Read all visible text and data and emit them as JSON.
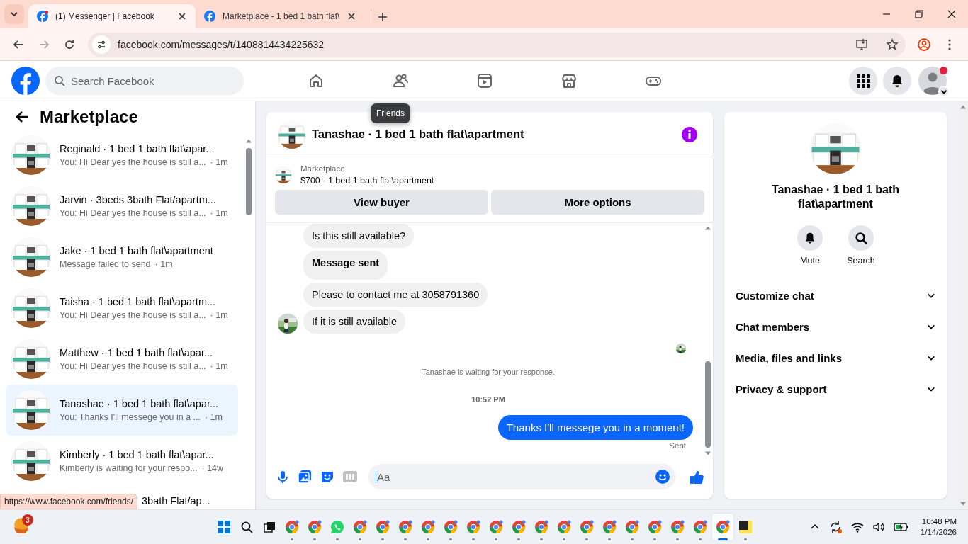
{
  "browser": {
    "tabs": [
      {
        "title": "(1) Messenger | Facebook",
        "selected": true,
        "unread": true
      },
      {
        "title": "Marketplace - 1 bed 1 bath flat\\",
        "selected": false,
        "unread": false
      }
    ],
    "url": "facebook.com/messages/t/1408814434225632"
  },
  "topnav": {
    "search_placeholder": "Search Facebook",
    "profile_alert": true,
    "tooltip": "Friends"
  },
  "sidebar": {
    "title": "Marketplace",
    "conversations": [
      {
        "kind": "full",
        "name": "Reginald · 1 bed 1 bath flat\\apar...",
        "preview": "You: Hi Dear yes the house is still a...",
        "time": "· 1m",
        "selected": false
      },
      {
        "kind": "full",
        "name": "Jarvin · 3beds 3bath Flat/apartm...",
        "preview": "You: Hi Dear yes the house is still a...",
        "time": "· 1m",
        "selected": false
      },
      {
        "kind": "full",
        "name": "Jake · 1 bed 1 bath flat\\apartment",
        "preview": "Message failed to send",
        "time": "· 1m",
        "selected": false
      },
      {
        "kind": "full",
        "name": "Taisha · 1 bed 1 bath flat\\apartm...",
        "preview": "You: Hi Dear yes the house is still a...",
        "time": "· 1m",
        "selected": false
      },
      {
        "kind": "full",
        "name": "Matthew · 1 bed 1 bath flat\\apar...",
        "preview": "You: Hi Dear yes the house is still a...",
        "time": "· 1m",
        "selected": false
      },
      {
        "kind": "full",
        "name": "Tanashae · 1 bed 1 bath flat\\apar...",
        "preview": "You: Thanks I'll messege you in a ...",
        "time": "· 1m",
        "selected": true
      },
      {
        "kind": "full",
        "name": "Kimberly · 1 bed 1 bath flat\\apar...",
        "preview": "Kimberly is waiting for your respo...",
        "time": "· 14w",
        "selected": false
      },
      {
        "kind": "partial",
        "name": "3bath Flat/ap...",
        "selected": false
      }
    ],
    "link_preview": "https://www.facebook.com/friends/"
  },
  "chat": {
    "title": "Tanashae · 1 bed 1 bath flat\\apartment",
    "listing": {
      "label": "Marketplace",
      "title": "$700 - 1 bed 1 bath flat\\apartment"
    },
    "buttons": [
      "View buyer",
      "More options"
    ],
    "messages": [
      {
        "kind": "incoming",
        "text": "Is this still available?"
      },
      {
        "kind": "incoming_bold",
        "text": "Message sent"
      },
      {
        "kind": "incoming",
        "text": "Please to contact me at 3058791360"
      },
      {
        "kind": "incoming_avatar",
        "text": "If it is still available"
      },
      {
        "kind": "read_receipt"
      },
      {
        "kind": "notice",
        "text": "Tanashae is waiting for your response."
      },
      {
        "kind": "timestamp",
        "text": "10:52 PM"
      },
      {
        "kind": "outgoing",
        "text": "Thanks I'll messege you in a moment!"
      },
      {
        "kind": "status",
        "text": "Sent"
      }
    ],
    "composer": {
      "placeholder": "Aa"
    }
  },
  "info": {
    "name": "Tanashae · 1 bed 1 bath flat\\apartment",
    "actions": [
      {
        "kind": "mute",
        "label": "Mute"
      },
      {
        "kind": "search",
        "label": "Search"
      }
    ],
    "sections": [
      {
        "label": "Customize chat",
        "expanded": false
      },
      {
        "label": "Chat members",
        "expanded": false
      },
      {
        "label": "Media, files and links",
        "expanded": false
      },
      {
        "label": "Privacy & support",
        "expanded": false
      }
    ]
  },
  "taskbar": {
    "weather_badge": "3",
    "apps": [
      {
        "kind": "start",
        "selected": false
      },
      {
        "kind": "search",
        "selected": false
      },
      {
        "kind": "taskview",
        "selected": false
      },
      {
        "kind": "chrome",
        "selected": false
      },
      {
        "kind": "chrome",
        "selected": false
      },
      {
        "kind": "whatsapp",
        "selected": false
      },
      {
        "kind": "chrome",
        "selected": false
      },
      {
        "kind": "chrome",
        "selected": false
      },
      {
        "kind": "chrome",
        "selected": false
      },
      {
        "kind": "chrome",
        "selected": false
      },
      {
        "kind": "chrome",
        "selected": false
      },
      {
        "kind": "chrome",
        "selected": false
      },
      {
        "kind": "chrome",
        "selected": false
      },
      {
        "kind": "chrome",
        "selected": false
      },
      {
        "kind": "chrome",
        "selected": false
      },
      {
        "kind": "chrome",
        "selected": false
      },
      {
        "kind": "chrome",
        "selected": false
      },
      {
        "kind": "chrome",
        "selected": false
      },
      {
        "kind": "chrome",
        "selected": false
      },
      {
        "kind": "chrome",
        "selected": false
      },
      {
        "kind": "chrome",
        "selected": false
      },
      {
        "kind": "chrome",
        "selected": false
      },
      {
        "kind": "chrome",
        "selected": true
      },
      {
        "kind": "notes",
        "selected": false
      }
    ],
    "time": "10:48 PM",
    "date": "1/14/2026"
  }
}
